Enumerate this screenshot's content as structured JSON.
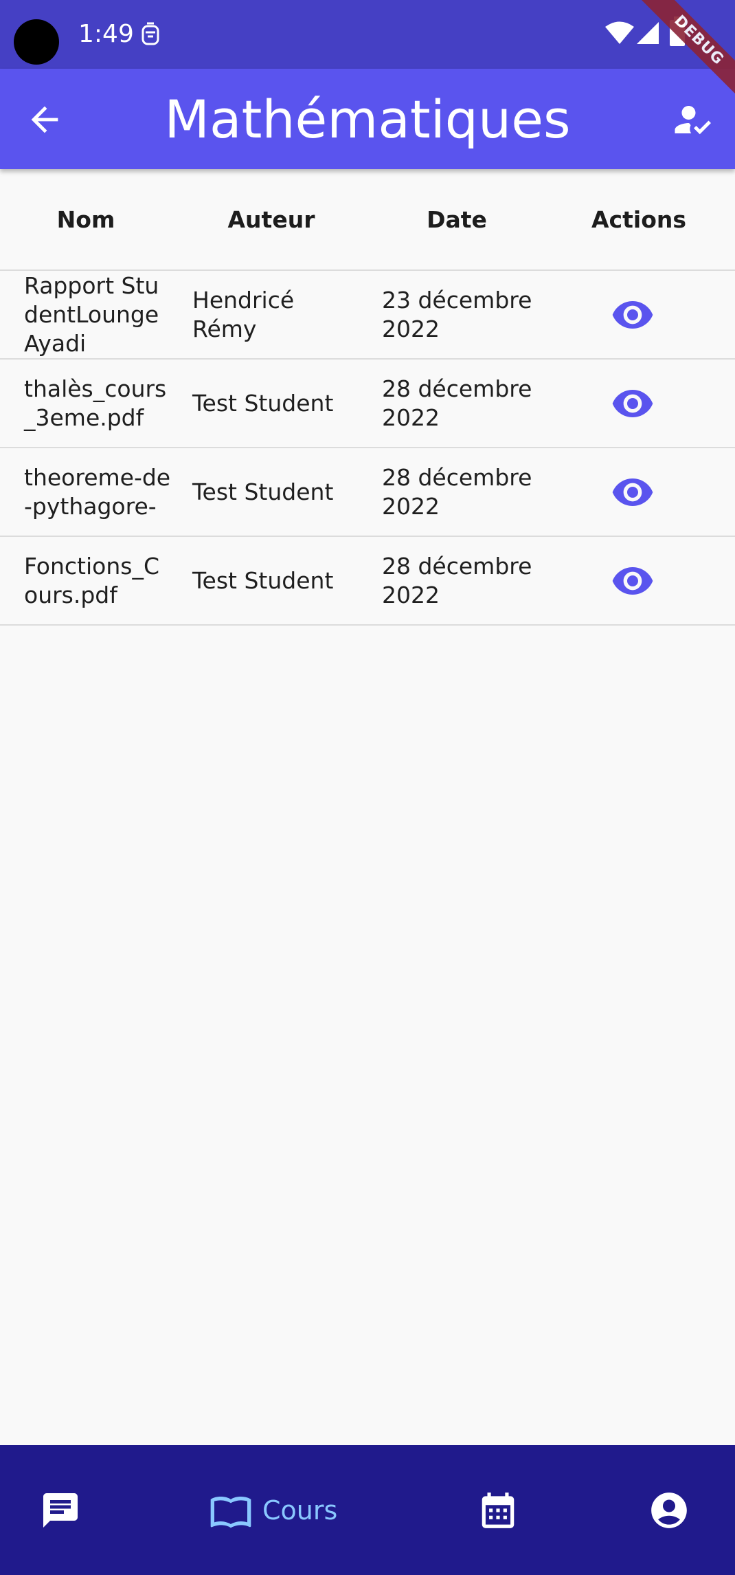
{
  "status_bar": {
    "time": "1:49"
  },
  "debug_banner": "DEBUG",
  "app_bar": {
    "title": "Mathématiques"
  },
  "table": {
    "headers": [
      "Nom",
      "Auteur",
      "Date",
      "Actions"
    ],
    "rows": [
      {
        "name": "Rapport StudentLounge Ayadi",
        "author": "Hendricé Rémy",
        "date": "23 décembre 2022"
      },
      {
        "name": "thalès_cours_3eme.pdf",
        "author": "Test Student",
        "date": "28 décembre 2022"
      },
      {
        "name": "theoreme-de-pythagore-",
        "author": "Test Student",
        "date": "28 décembre 2022"
      },
      {
        "name": "Fonctions_Cours.pdf",
        "author": "Test Student",
        "date": "28 décembre 2022"
      }
    ]
  },
  "bottom_nav": {
    "items": [
      {
        "icon": "chat-icon",
        "label": ""
      },
      {
        "icon": "book-icon",
        "label": "Cours",
        "active": true
      },
      {
        "icon": "calendar-icon",
        "label": ""
      },
      {
        "icon": "account-icon",
        "label": ""
      }
    ]
  },
  "colors": {
    "status_bar": "#4540c4",
    "app_bar": "#5a54ee",
    "bottom_nav": "#201a8c",
    "accent": "#5a54ee",
    "active_nav": "#8ac8ff"
  }
}
